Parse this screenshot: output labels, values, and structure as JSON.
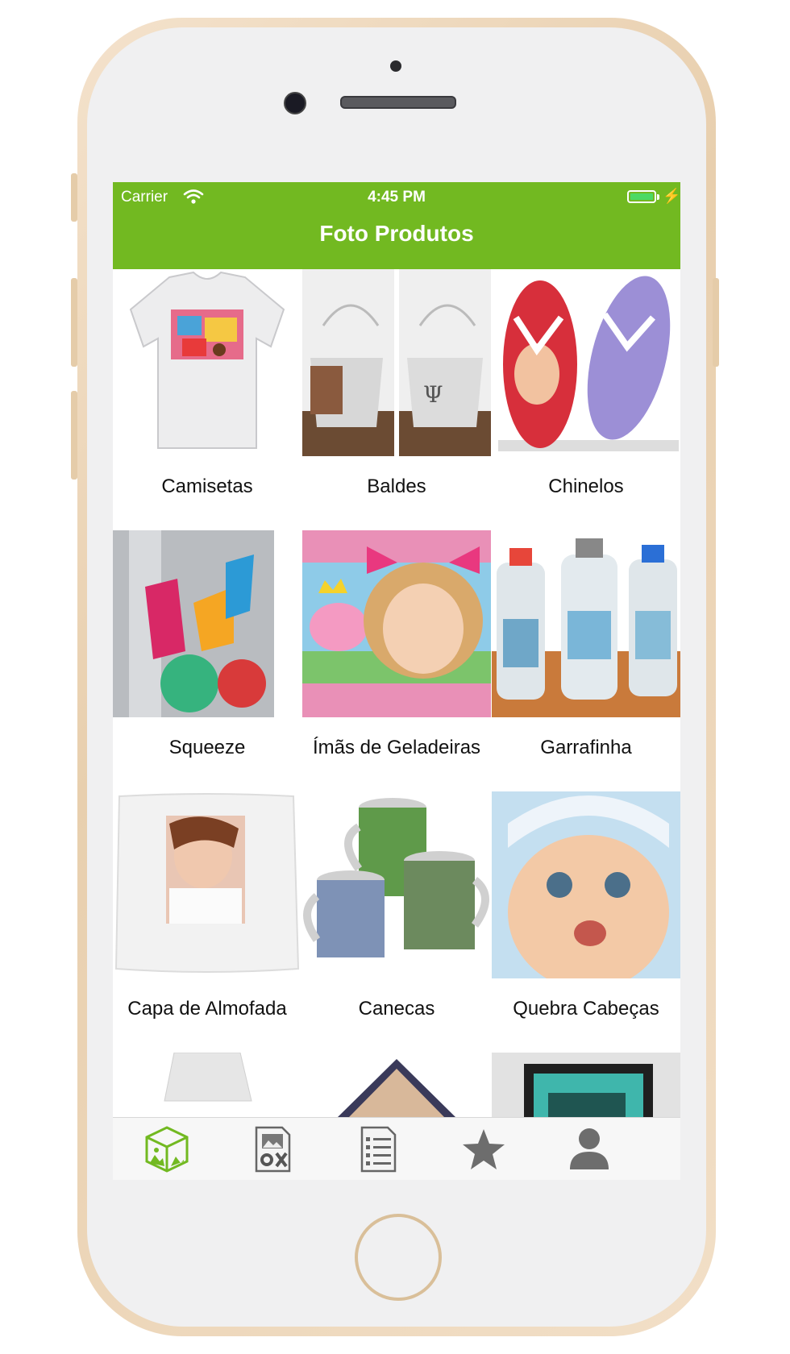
{
  "status_bar": {
    "carrier": "Carrier",
    "time": "4:45 PM"
  },
  "nav": {
    "title": "Foto Produtos"
  },
  "accent_color": "#72b921",
  "products": [
    {
      "label": "Camisetas",
      "image": "tshirt"
    },
    {
      "label": "Baldes",
      "image": "buckets"
    },
    {
      "label": "Chinelos",
      "image": "flip-flops"
    },
    {
      "label": "Squeeze",
      "image": "squeeze-bottle"
    },
    {
      "label": "Ímãs de Geladeiras",
      "image": "fridge-magnet"
    },
    {
      "label": "Garrafinha",
      "image": "small-bottles"
    },
    {
      "label": "Capa de Almofada",
      "image": "pillow-cover"
    },
    {
      "label": "Canecas",
      "image": "mugs"
    },
    {
      "label": "Quebra Cabeças",
      "image": "puzzle"
    },
    {
      "label": "",
      "image": "apron"
    },
    {
      "label": "",
      "image": "photo-frame"
    },
    {
      "label": "",
      "image": "wall-frame"
    }
  ],
  "tabs": [
    {
      "icon": "products-cube-icon",
      "active": true
    },
    {
      "icon": "image-tools-icon",
      "active": false
    },
    {
      "icon": "orders-list-icon",
      "active": false
    },
    {
      "icon": "favorites-star-icon",
      "active": false
    },
    {
      "icon": "profile-person-icon",
      "active": false
    }
  ]
}
